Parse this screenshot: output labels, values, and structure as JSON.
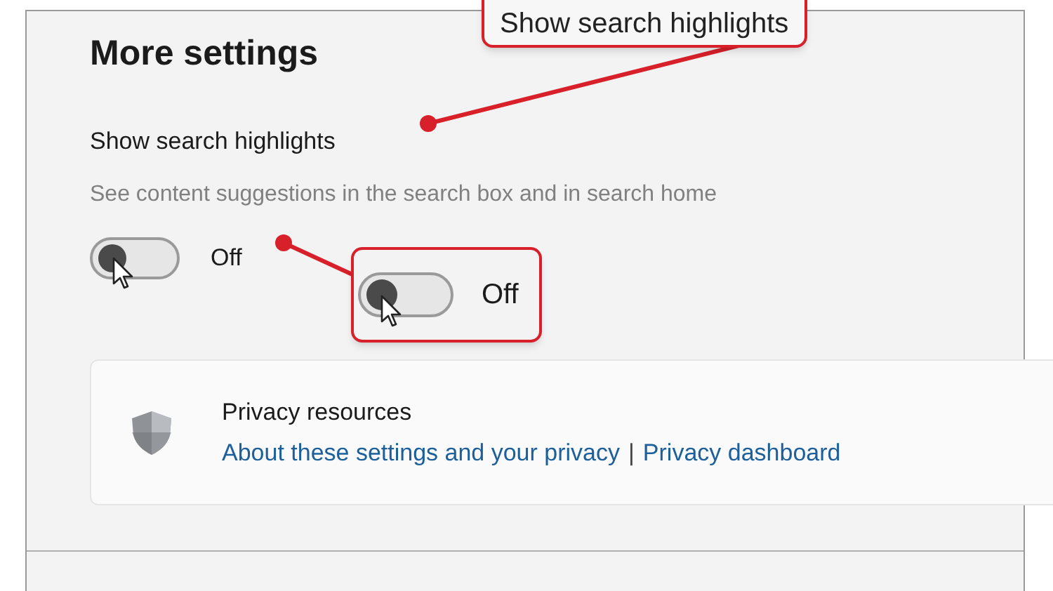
{
  "title": "More settings",
  "setting": {
    "label": "Show search highlights",
    "description": "See content suggestions in the search box and in search home",
    "on": false,
    "state_text": "Off"
  },
  "callouts": [
    {
      "kind": "label",
      "text": "Show search highlights"
    },
    {
      "kind": "toggle",
      "on": false,
      "state_text": "Off"
    }
  ],
  "privacy": {
    "title": "Privacy resources",
    "links": [
      "About these settings and your privacy",
      "Privacy dashboard"
    ],
    "separator": "|"
  }
}
